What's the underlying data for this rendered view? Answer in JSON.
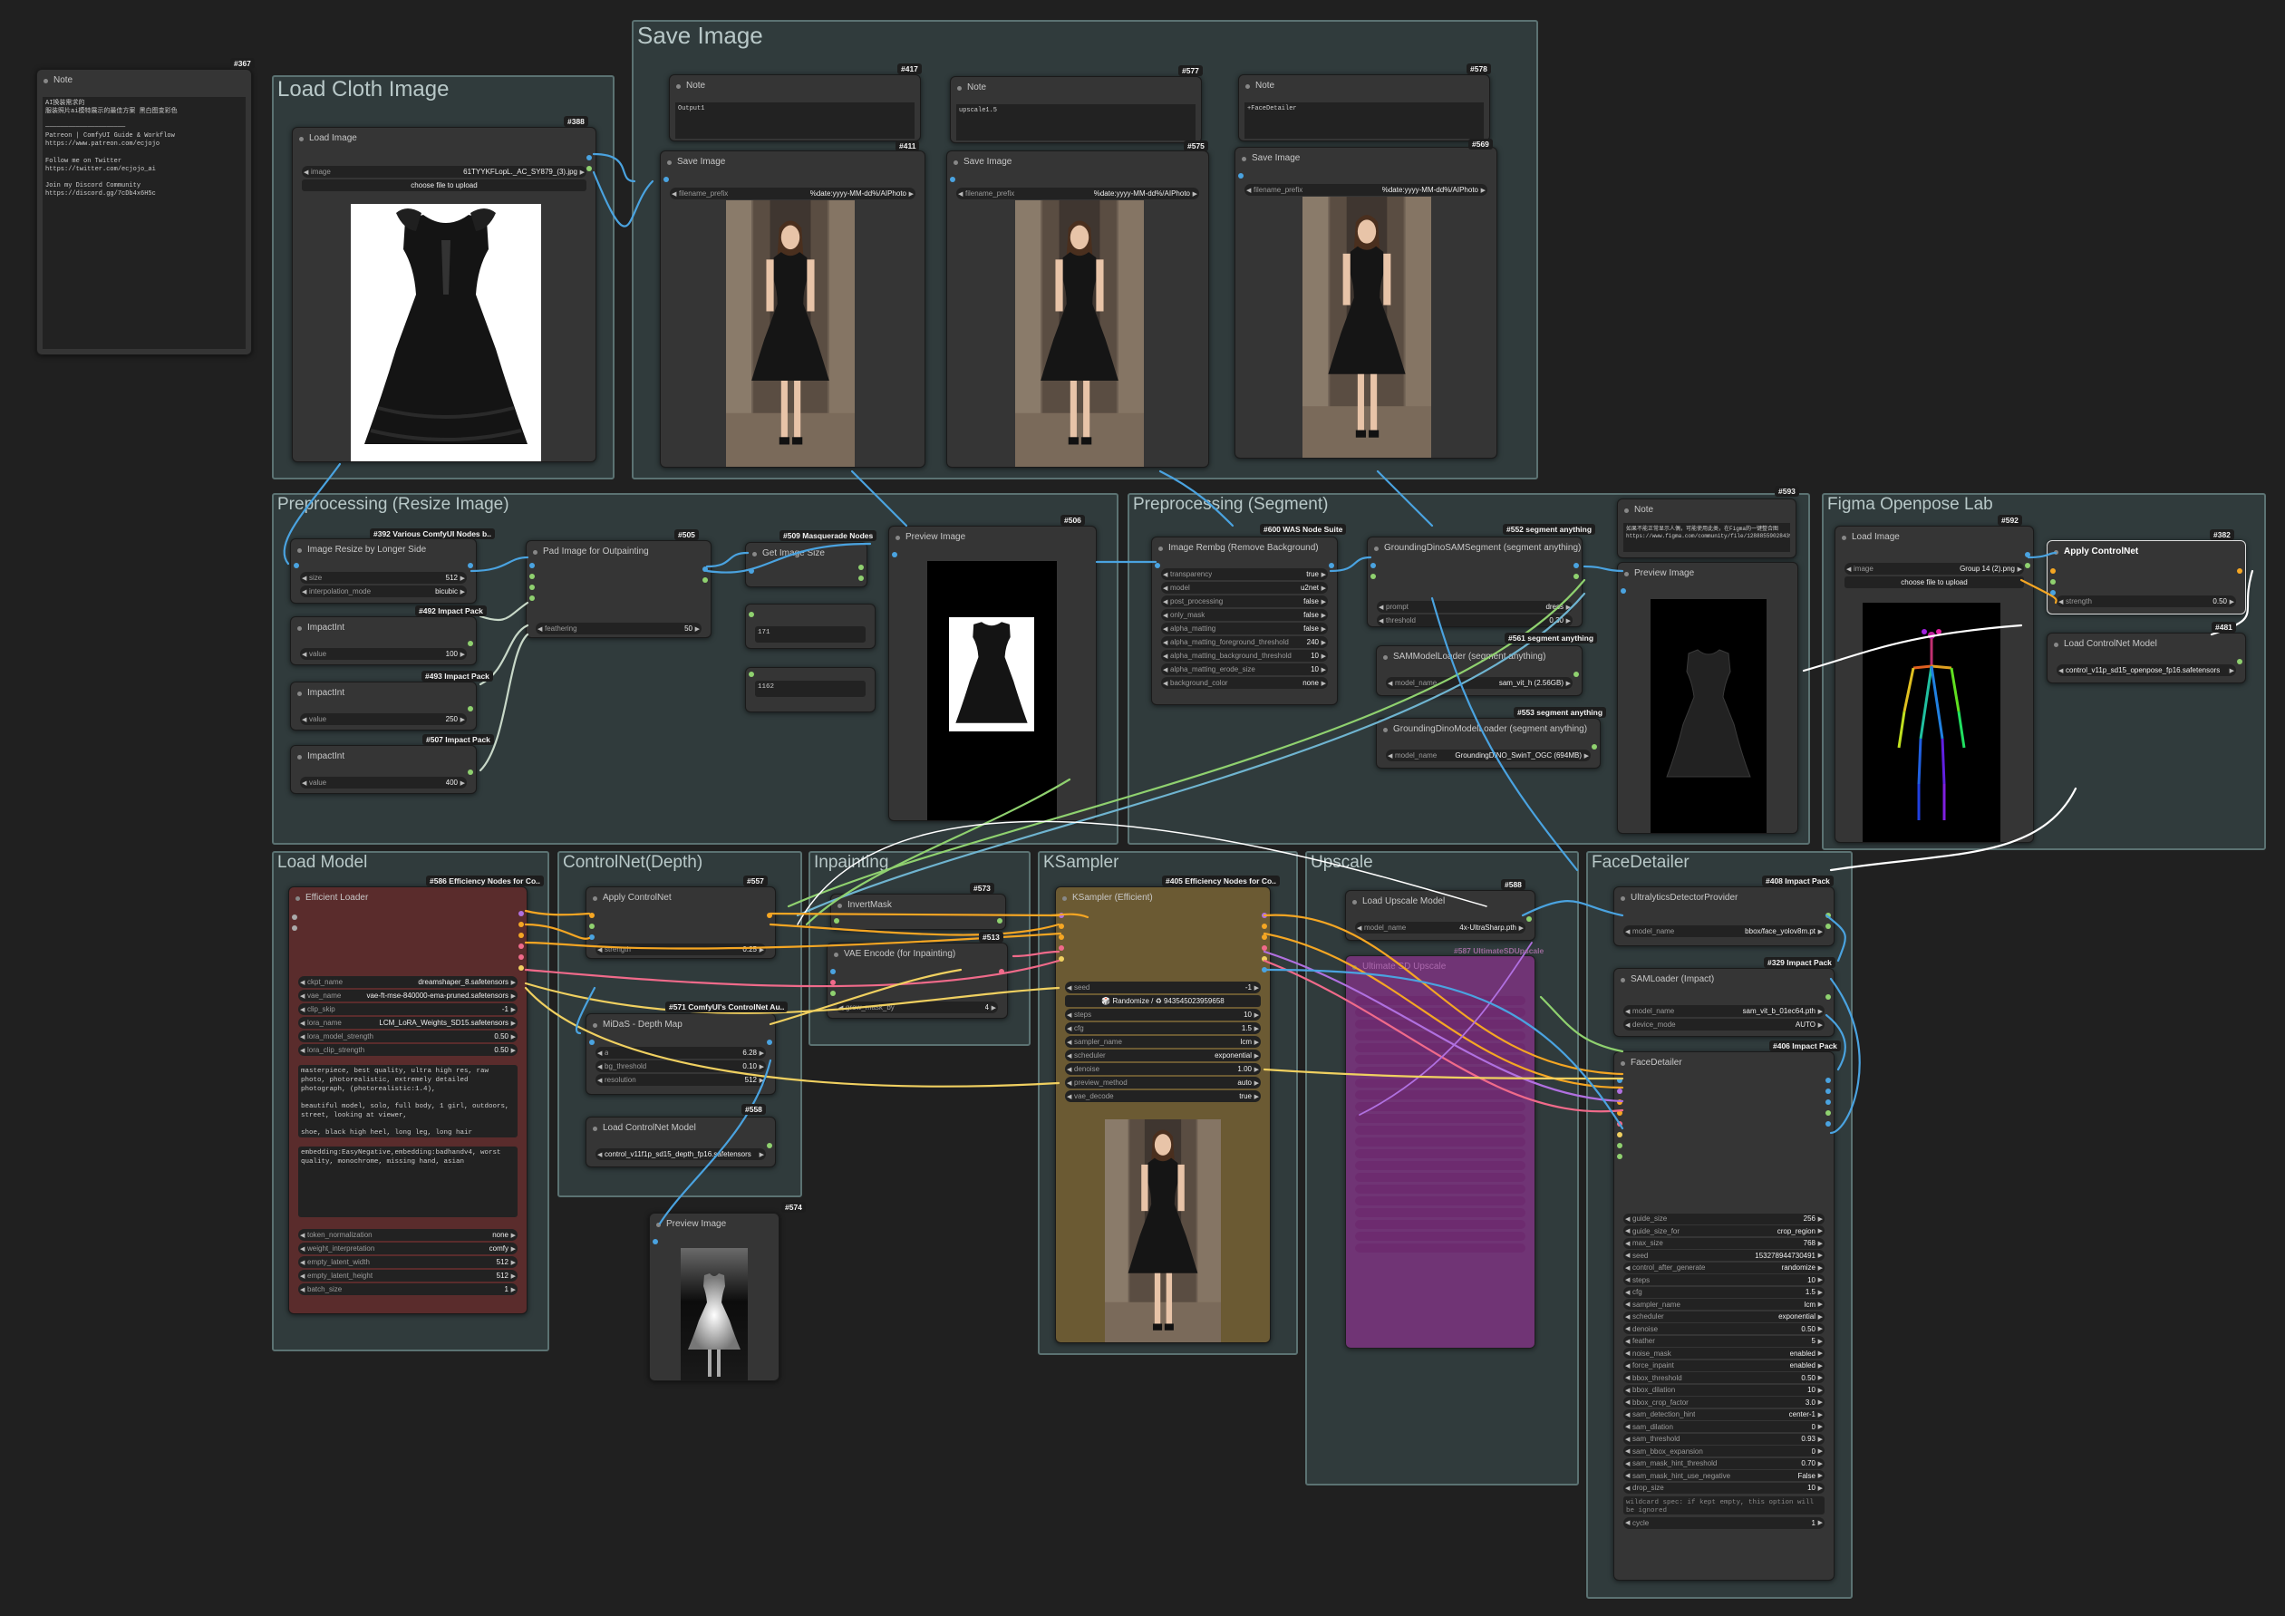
{
  "groups": {
    "load_cloth": "Load Cloth Image",
    "save_image": "Save Image",
    "pre_resize": "Preprocessing (Resize Image)",
    "pre_segment": "Preprocessing (Segment)",
    "figma": "Figma Openpose Lab",
    "load_model": "Load Model",
    "controlnet_depth": "ControlNet(Depth)",
    "inpainting": "Inpainting",
    "ksampler": "KSampler",
    "upscale": "Upscale",
    "facedetailer": "FaceDetailer"
  },
  "note_main": {
    "id": "#367",
    "title": "Note",
    "body": "AI换装需求的\n服装照片ai模特展示的最佳方案 黑白图变彩色\n\n─────────────────────\nPatreon | ComfyUI Guide & Workflow\nhttps://www.patreon.com/ecjojo\n\nFollow me on Twitter\nhttps://twitter.com/ecjojo_ai\n\nJoin my Discord Community\nhttps://discord.gg/7cDb4x6H5c"
  },
  "load_image_cloth": {
    "id": "#388",
    "title": "Load Image",
    "image_label": "image",
    "image_value": "61TYYKFLopL._AC_SY879_(3).jpg",
    "upload": "choose file to upload"
  },
  "save_notes": [
    {
      "id": "#417",
      "title": "Note",
      "text": "Output1"
    },
    {
      "id": "#577",
      "title": "Note",
      "text": "upscale1.5"
    },
    {
      "id": "#578",
      "title": "Note",
      "text": "+FaceDetailer"
    }
  ],
  "save_nodes": [
    {
      "id": "#411",
      "title": "Save Image",
      "label": "filename_prefix",
      "value": "%date:yyyy-MM-dd%/AIPhoto"
    },
    {
      "id": "#575",
      "title": "Save Image",
      "label": "filename_prefix",
      "value": "%date:yyyy-MM-dd%/AIPhoto"
    },
    {
      "id": "#569",
      "title": "Save Image",
      "label": "filename_prefix",
      "value": "%date:yyyy-MM-dd%/AIPhoto"
    }
  ],
  "resize_node": {
    "id": "#392",
    "pack": "Various ComfyUI Nodes b..",
    "title": "Image Resize by Longer Side",
    "size_label": "size",
    "size": "512",
    "interp_label": "interpolation_mode",
    "interp": "bicubic"
  },
  "impact_ints": [
    {
      "id": "#492",
      "pack": "Impact Pack",
      "title": "ImpactInt",
      "label": "value",
      "value": "100"
    },
    {
      "id": "#493",
      "pack": "Impact Pack",
      "title": "ImpactInt",
      "label": "value",
      "value": "250"
    },
    {
      "id": "#507",
      "pack": "Impact Pack",
      "title": "ImpactInt",
      "label": "value",
      "value": "400"
    }
  ],
  "pad_node": {
    "id": "#505",
    "title": "Pad Image for Outpainting",
    "label": "feathering",
    "value": "50"
  },
  "get_size": {
    "id": "#509",
    "pack": "Masquerade Nodes",
    "title": "Get Image Size",
    "w": "171",
    "h": "1162"
  },
  "preview_resize": {
    "id": "#506",
    "title": "Preview Image"
  },
  "rembg": {
    "id": "#600",
    "pack": "WAS Node Suite",
    "title": "Image Rembg (Remove Background)",
    "rows": [
      {
        "label": "transparency",
        "value": "true"
      },
      {
        "label": "model",
        "value": "u2net"
      },
      {
        "label": "post_processing",
        "value": "false"
      },
      {
        "label": "only_mask",
        "value": "false"
      },
      {
        "label": "alpha_matting",
        "value": "false"
      },
      {
        "label": "alpha_matting_foreground_threshold",
        "value": "240"
      },
      {
        "label": "alpha_matting_background_threshold",
        "value": "10"
      },
      {
        "label": "alpha_matting_erode_size",
        "value": "10"
      },
      {
        "label": "background_color",
        "value": "none"
      }
    ]
  },
  "gdino_seg": {
    "id": "#552",
    "pack": "segment anything",
    "title": "GroundingDinoSAMSegment (segment anything)",
    "prompt_label": "prompt",
    "prompt": "dress",
    "thr_label": "threshold",
    "thr": "0.30"
  },
  "sam_loader": {
    "id": "#561",
    "pack": "segment anything",
    "title": "SAMModelLoader (segment anything)",
    "label": "model_name",
    "value": "sam_vit_h (2.56GB)"
  },
  "gdino_loader": {
    "id": "#553",
    "pack": "segment anything",
    "title": "GroundingDinoModelLoader (segment anything)",
    "label": "model_name",
    "value": "GroundingDINO_SwinT_OGC (694MB)"
  },
  "note_figma": {
    "id": "#593",
    "title": "Note",
    "text": "如果不能正常显示人偶，可能使用此类，在Figma的一键整合图\nhttps://www.figma.com/community/file/1288855902843957"
  },
  "preview_seg": {
    "title": "Preview Image"
  },
  "figma_load": {
    "id": "#592",
    "title": "Load Image",
    "image_label": "image",
    "image_value": "Group 14 (2).png",
    "upload": "choose file to upload"
  },
  "apply_cn_figma": {
    "id": "#382",
    "title": "Apply ControlNet",
    "label": "strength",
    "value": "0.50"
  },
  "load_cn_figma": {
    "id": "#481",
    "title": "Load ControlNet Model",
    "value": "control_v11p_sd15_openpose_fp16.safetensors"
  },
  "eff_loader": {
    "id": "#586",
    "pack": "Efficiency Nodes for Co..",
    "title": "Efficient Loader",
    "rows": [
      {
        "label": "ckpt_name",
        "value": "dreamshaper_8.safetensors"
      },
      {
        "label": "vae_name",
        "value": "vae-ft-mse-840000-ema-pruned.safetensors"
      },
      {
        "label": "clip_skip",
        "value": "-1"
      },
      {
        "label": "lora_name",
        "value": "LCM_LoRA_Weights_SD15.safetensors"
      },
      {
        "label": "lora_model_strength",
        "value": "0.50"
      },
      {
        "label": "lora_clip_strength",
        "value": "0.50"
      }
    ],
    "positive": "masterpiece, best quality, ultra high res, raw photo, photorealistic, extremely detailed photograph, (photorealistic:1.4),\n\nbeautiful model, solo, full body, 1 girl, outdoors, street, looking at viewer,\n\nshoe, black high heel, long leg, long hair",
    "negative": "embedding:EasyNegative,embedding:badhandv4, worst quality, monochrome, missing hand, asian",
    "rows2": [
      {
        "label": "token_normalization",
        "value": "none"
      },
      {
        "label": "weight_interpretation",
        "value": "comfy"
      },
      {
        "label": "empty_latent_width",
        "value": "512"
      },
      {
        "label": "empty_latent_height",
        "value": "512"
      },
      {
        "label": "batch_size",
        "value": "1"
      }
    ]
  },
  "apply_cn_depth": {
    "id": "#557",
    "title": "Apply ControlNet",
    "label": "strength",
    "value": "0.25"
  },
  "midas": {
    "id": "#571",
    "pack": "ComfyUI's ControlNet Au..",
    "title": "MiDaS - Depth Map",
    "rows": [
      {
        "label": "a",
        "value": "6.28"
      },
      {
        "label": "bg_threshold",
        "value": "0.10"
      },
      {
        "label": "resolution",
        "value": "512"
      }
    ]
  },
  "load_cn_depth": {
    "id": "#558",
    "title": "Load ControlNet Model",
    "value": "control_v11f1p_sd15_depth_fp16.safetensors"
  },
  "preview_depth": {
    "id": "#574",
    "title": "Preview Image"
  },
  "invert_mask": {
    "id": "#573",
    "title": "InvertMask"
  },
  "vae_encode": {
    "id": "#513",
    "title": "VAE Encode (for Inpainting)",
    "label": "grow_mask_by",
    "value": "4"
  },
  "ksampler": {
    "id": "#405",
    "pack": "Efficiency Nodes for Co..",
    "title": "KSampler (Efficient)",
    "seed_label": "seed",
    "seed": "-1",
    "randomize": "🎲 Randomize / ♻ 943545023959658",
    "rows": [
      {
        "label": "steps",
        "value": "10"
      },
      {
        "label": "cfg",
        "value": "1.5"
      },
      {
        "label": "sampler_name",
        "value": "lcm"
      },
      {
        "label": "scheduler",
        "value": "exponential"
      },
      {
        "label": "denoise",
        "value": "1.00"
      },
      {
        "label": "preview_method",
        "value": "auto"
      },
      {
        "label": "vae_decode",
        "value": "true"
      }
    ]
  },
  "upscale_loader": {
    "id": "#588",
    "title": "Load Upscale Model",
    "label": "model_name",
    "value": "4x-UltraSharp.pth"
  },
  "ultimate_upscale": {
    "id": "#587",
    "pack": "UltimateSDUpscale",
    "title": "Ultimate SD Upscale"
  },
  "face_provider": {
    "id": "#408",
    "pack": "Impact Pack",
    "title": "UltralyticsDetectorProvider",
    "label": "model_name",
    "value": "bbox/face_yolov8m.pt"
  },
  "sam_impact": {
    "id": "#329",
    "pack": "Impact Pack",
    "title": "SAMLoader (Impact)",
    "rows": [
      {
        "label": "model_name",
        "value": "sam_vit_b_01ec64.pth"
      },
      {
        "label": "device_mode",
        "value": "AUTO"
      }
    ]
  },
  "face_detailer": {
    "id": "#406",
    "pack": "Impact Pack",
    "title": "FaceDetailer",
    "rows": [
      {
        "label": "guide_size",
        "value": "256"
      },
      {
        "label": "guide_size_for",
        "value": "crop_region"
      },
      {
        "label": "max_size",
        "value": "768"
      },
      {
        "label": "seed",
        "value": "153278944730491"
      },
      {
        "label": "control_after_generate",
        "value": "randomize"
      },
      {
        "label": "steps",
        "value": "10"
      },
      {
        "label": "cfg",
        "value": "1.5"
      },
      {
        "label": "sampler_name",
        "value": "lcm"
      },
      {
        "label": "scheduler",
        "value": "exponential"
      },
      {
        "label": "denoise",
        "value": "0.50"
      },
      {
        "label": "feather",
        "value": "5"
      },
      {
        "label": "noise_mask",
        "value": "enabled"
      },
      {
        "label": "force_inpaint",
        "value": "enabled"
      },
      {
        "label": "bbox_threshold",
        "value": "0.50"
      },
      {
        "label": "bbox_dilation",
        "value": "10"
      },
      {
        "label": "bbox_crop_factor",
        "value": "3.0"
      },
      {
        "label": "sam_detection_hint",
        "value": "center-1"
      },
      {
        "label": "sam_dilation",
        "value": "0"
      },
      {
        "label": "sam_threshold",
        "value": "0.93"
      },
      {
        "label": "sam_bbox_expansion",
        "value": "0"
      },
      {
        "label": "sam_mask_hint_threshold",
        "value": "0.70"
      },
      {
        "label": "sam_mask_hint_use_negative",
        "value": "False"
      },
      {
        "label": "drop_size",
        "value": "10"
      }
    ],
    "wildcard": "wildcard spec: if kept empty, this option will be ignored",
    "cycle_label": "cycle",
    "cycle": "1"
  },
  "colors": {
    "canvas": "#202020",
    "group_border": "#5b7272",
    "node": "#353535",
    "efficient_loader": "#5a2c2c",
    "ksampler": "#6b5a33",
    "upscale": "#7a2f7a",
    "wire_blue": "#4aa3e0",
    "wire_orange": "#f5a623",
    "wire_pink": "#f06a8a",
    "wire_yellow": "#f0d060",
    "wire_green": "#8fd16f",
    "wire_purple": "#b070e0"
  }
}
